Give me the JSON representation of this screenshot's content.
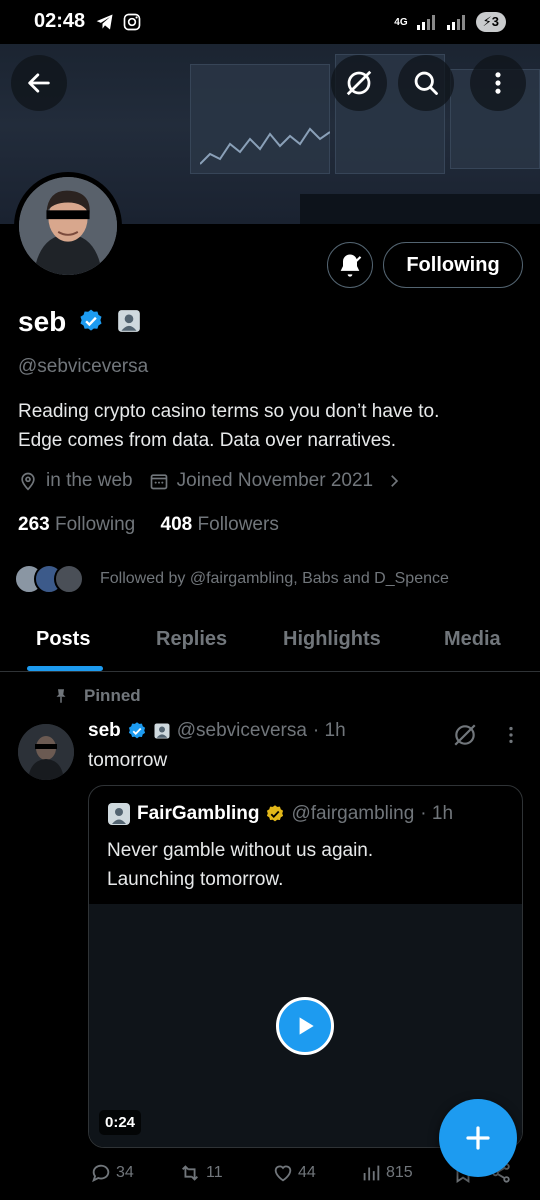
{
  "status_bar": {
    "time": "02:48",
    "network": "4G",
    "battery": "3"
  },
  "header": {
    "back_label": "Back",
    "grok_label": "Grok",
    "search_label": "Search",
    "more_label": "More"
  },
  "profile": {
    "name": "seb",
    "handle": "@sebviceversa",
    "bio_line1": "Reading crypto casino terms so you don’t have to.",
    "bio_line2": "Edge comes from data. Data over narratives.",
    "location": "in the web",
    "joined": "Joined November 2021",
    "following_count": "263",
    "following_label": "Following",
    "followers_count": "408",
    "followers_label": "Followers",
    "followed_by": "Followed by @fairgambling, Babs and D_Spence",
    "follow_button": "Following"
  },
  "tabs": [
    "Posts",
    "Replies",
    "Highlights",
    "Media"
  ],
  "post": {
    "pinned_label": "Pinned",
    "author_name": "seb",
    "author_handle": "@sebviceversa",
    "time": "· 1h",
    "text": "tomorrow",
    "quote": {
      "name": "FairGambling",
      "handle": "@fairgambling",
      "time": "· 1h",
      "line1": "Never gamble without us again.",
      "line2": "Launching tomorrow.",
      "duration": "0:24"
    },
    "replies": "34",
    "reposts": "11",
    "likes": "44",
    "views": "815"
  },
  "colors": {
    "accent": "#1d9bf0",
    "verified": "#1d9bf0",
    "gold": "#e2b719",
    "muted": "#71767b"
  }
}
